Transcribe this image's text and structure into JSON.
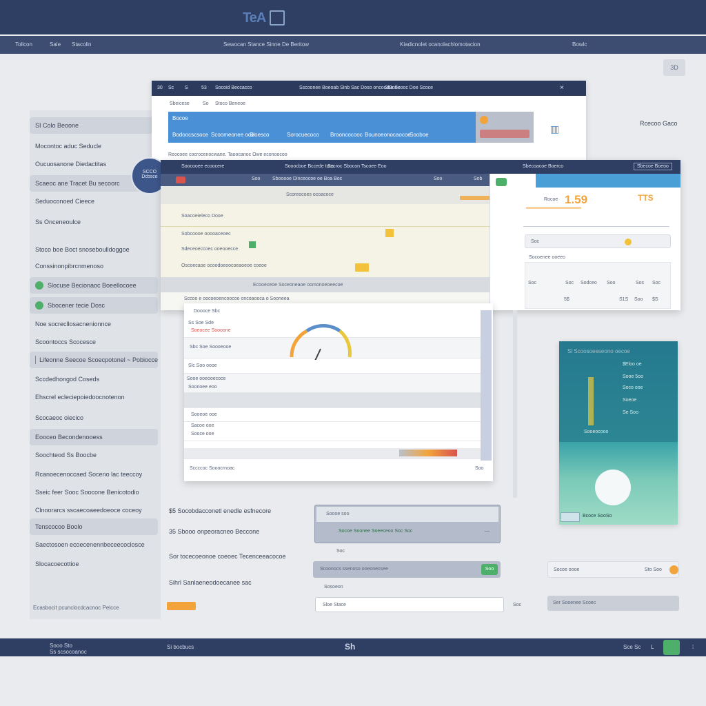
{
  "header": {
    "logo_text": "TeA",
    "nav": [
      "Tollcon",
      "Sale",
      "Stacolin",
      "Sewocan Stance Sinne  De  Beritow",
      "Kiadicnolet ocanolachlomotacion",
      "Bowlc"
    ]
  },
  "corner_button": "3D",
  "sidebar": {
    "items": [
      {
        "label": "SI Colo Beoone",
        "highlight": true,
        "dot": false
      },
      {
        "label": "Mocontoc aduc Seducle",
        "highlight": false,
        "dot": false
      },
      {
        "label": "Oucuosanone Diedactitas",
        "highlight": false,
        "dot": false
      },
      {
        "label": "Scaeoc ane Tracet Bu secoorc",
        "highlight": true,
        "dot": false
      },
      {
        "label": "Seduoconoed Cieece",
        "highlight": false,
        "dot": false
      },
      {
        "label": "Ss Onceneoulce",
        "highlight": false,
        "dot": false
      },
      {
        "label": "Stoco boe  Boct snoseboulldoggoe",
        "highlight": false,
        "dot": false
      },
      {
        "label": "Conssinonpibrcnmenoso",
        "highlight": false,
        "dot": false
      },
      {
        "label": "Slocuse  Becionaoc  Boeellocoee",
        "highlight": true,
        "dot": true
      },
      {
        "label": "Sbocener tecie Dosc",
        "highlight": true,
        "dot": true
      },
      {
        "label": "Noe socrecllosacnenionnce",
        "highlight": false,
        "dot": false
      },
      {
        "label": "Scoontoccs  Scocesce",
        "highlight": false,
        "dot": false
      },
      {
        "label": "Lifeonne  Seecoe  Scoecpotonel  ~ Pobiocce",
        "highlight": true,
        "dot": true
      },
      {
        "label": "Sccdedhongod Coseds",
        "highlight": false,
        "dot": false
      },
      {
        "label": "Ehscrel  ecleciepoiedoocnotenon",
        "highlight": false,
        "dot": false
      },
      {
        "label": "Scocaeoc oiecico",
        "highlight": false,
        "dot": false
      },
      {
        "label": "Eooceo Becondenooess",
        "highlight": true,
        "dot": false
      },
      {
        "label": "Soochteod  Ss  Boocbe",
        "highlight": false,
        "dot": false
      },
      {
        "label": "Rcanoecenoccaed  Soceno lac teeccoy",
        "highlight": false,
        "dot": false
      },
      {
        "label": "Sseic feer  Sooc  Soocone  Benicotodio",
        "highlight": false,
        "dot": false
      },
      {
        "label": "Clnoorarcs  sscaecoaeedoeoce coceoy",
        "highlight": false,
        "dot": false
      },
      {
        "label": "Tenscocoo Boolo",
        "highlight": true,
        "dot": false
      },
      {
        "label": "Saectosoen  ecoecenennbeceecoclosce",
        "highlight": false,
        "dot": false
      },
      {
        "label": "Slocacoecottioe",
        "highlight": false,
        "dot": false
      }
    ],
    "footer": "Ecasbocit pcunclocdcacnoc Pelcce"
  },
  "window1": {
    "title_items": [
      "30",
      "Sc",
      "S",
      "53",
      "Socoid Beccacco",
      "Sscoonee Boeoab Sinb Sac Doso oncoceDooe",
      "Sbe  Scooc  Doe  Scoce"
    ],
    "subtitle": "Sbeicese",
    "subtitle2": "Stoco Beneoe",
    "sub_num": "So",
    "tabs": [
      "Bocoe",
      "Bodoocscsoce",
      "Scoomeonee ooe",
      "Sloesco",
      "Sorocuecoco",
      "Brooncocooc",
      "Bounoeonocaocoe",
      "Sooboe"
    ],
    "row_text": "Reocoee  cocrocenocwane.  Taoocanoc  Owe  econoocoo",
    "right_label": "Rcecoo Gaco"
  },
  "badge": {
    "line1": "SCCO",
    "line2": "Dcbsce"
  },
  "window2": {
    "title_items": [
      "Soocooee  ecoocere",
      "Sooocboe  Bccede  tocs",
      "Sccroc  Sbocon  Tscoee  Eoo",
      "Sbecoacoe  Boerco",
      "Sbecoe  Boeoo"
    ],
    "sub_items": [
      "Soo",
      "Sbooooe Dinceocoe oe Boa Boc",
      "Soo",
      "Sob"
    ],
    "rows": [
      "Scoreocoes  ocoacoce",
      "Soacoeieleco  Dooe",
      "Sobcoooe  ooooaceoec",
      "Sdeceoeccoec  ooeooecce",
      "Oscoecaoe  ocoodoeoocoeaoeoe  coeoe",
      "Ecooeceoe  Soceoneaoe oomonoeoeecoe"
    ],
    "bottom_row": "Sccoo e oocoeoencoocoo  oncoaooca  o  Sooneea"
  },
  "rightcard": {
    "price_label": "Rocoe",
    "price": "1.59",
    "price_right": "TTS",
    "field1": "Soc",
    "row_label": "Socoenee ooeeo",
    "cols": [
      "Soc",
      "Soc",
      "Sodceo",
      "Soo",
      "Sos",
      "Soc"
    ],
    "values": [
      "5$",
      "S1S",
      "Soo",
      "$S"
    ]
  },
  "window3": {
    "header": "Doooce Sbc",
    "rows": [
      "Ss  Soe  Sde",
      "Soeocee  Soooone",
      "Sbc  Soe  Soooeooe",
      "Slc  Soo  oooe",
      "Sooe  ooeooecoce",
      "Soonoee  eoo",
      "Sooeoe  ooe",
      "Sacoe  ooe",
      "Sooce  ooe"
    ],
    "footer": "Sccccoc  Sooocrnoac",
    "footer_right": "Soo"
  },
  "teal": {
    "title": "Sl  Scoosoeeseono oecoe",
    "rows": [
      "$Eloo  oe",
      "Sooe  5oo",
      "Soco  ooe",
      "Soeoe",
      "Se  Soo",
      "Sooeocooo"
    ],
    "button": "Bcoce  SooSo"
  },
  "form": {
    "left_labels": [
      "$5  Socobdacconetl  enedle  esfnecore",
      "35  Sbooo  onpeoracneo  Beccone",
      "Sor  tocecoeonoe coeoec  Tecenceeacocoe",
      "Sihrl  Sanlaeneodoecanee sac"
    ],
    "fields": [
      "Soooe  soo",
      "Socoe  Soonee  Soeeceoo  Soc  Soc",
      "Scoonocs  ssenoso  ooeonecsee",
      "Sosoeon",
      "Sloe  Stace",
      "Soo"
    ],
    "field_btn": "Soc",
    "right_fields": [
      "Socoe  oooe",
      "Sto  Soo",
      "Ser  Sooenee  Scoec"
    ]
  },
  "footer": {
    "left1": "Sooo Sto",
    "left2": "Ss  scsocoanoc",
    "mid": "Si bocbucs",
    "center": "Sh",
    "right": "Sce Sc",
    "right2": "L"
  },
  "colors": {
    "navy": "#2f3e63",
    "blue": "#4a90d6",
    "green": "#4daf6a",
    "orange": "#f2a43a",
    "teal": "#2f8fa0"
  }
}
